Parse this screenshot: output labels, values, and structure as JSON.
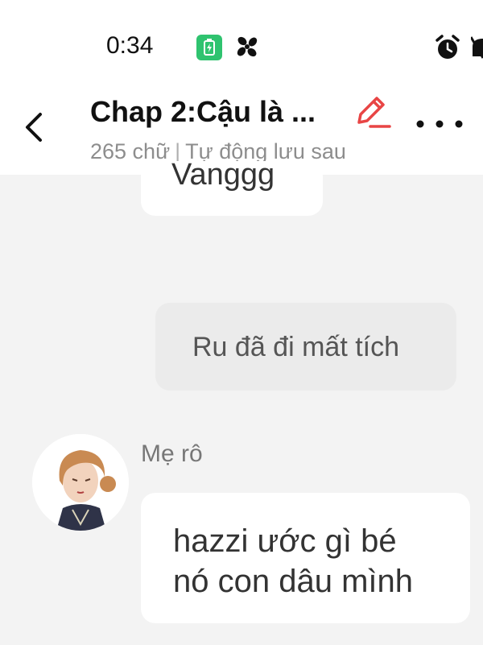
{
  "status_bar": {
    "time": "0:34",
    "icons": [
      "battery-saver-icon",
      "fan-icon",
      "alarm-icon",
      "bell-muted-icon"
    ],
    "accent_color": "#2fc36f"
  },
  "header": {
    "title": "Chap 2:Cậu là ...",
    "word_count": "265 chữ",
    "autosave": "Tự động lưu sau",
    "edit_icon_color": "#e84545"
  },
  "messages": [
    {
      "side": "right",
      "text": "Vanggg"
    },
    {
      "side": "right",
      "text": "Ru đã đi mất tích"
    },
    {
      "side": "left",
      "sender": "Mẹ rô",
      "lines": [
        "hazzi ước gì bé",
        "nó con dâu mình"
      ]
    }
  ]
}
